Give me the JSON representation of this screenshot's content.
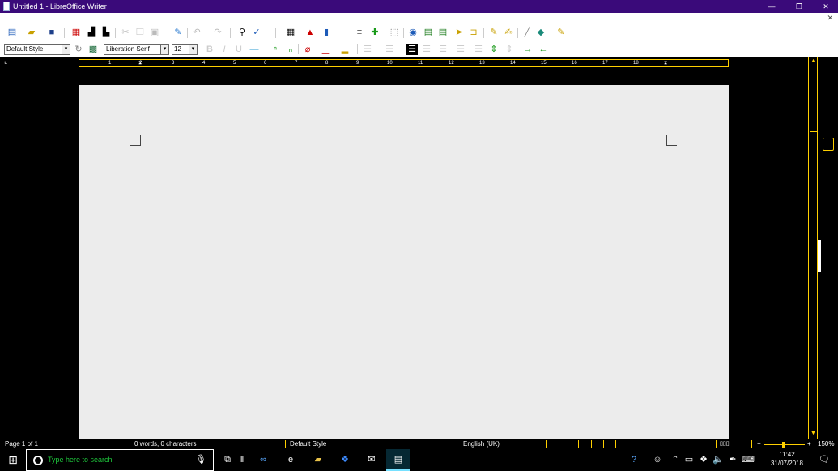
{
  "window": {
    "title": "Untitled 1 - LibreOffice Writer",
    "minimize": "—",
    "restore": "❐",
    "close": "✕"
  },
  "menubar": {
    "close_doc": "✕"
  },
  "toolbar_standard": {
    "icons": [
      "new-document",
      "open-folder",
      "save",
      "export-pdf",
      "print",
      "print-preview",
      "cut",
      "copy",
      "paste",
      "clone-formatting",
      "undo",
      "redo",
      "find-replace",
      "spelling",
      "insert-table",
      "insert-image",
      "insert-chart",
      "insert-text-box",
      "insert-page-break",
      "insert-field",
      "insert-special-character",
      "insert-hyperlink",
      "insert-footnote",
      "insert-endnote",
      "insert-bookmark",
      "insert-cross-reference",
      "insert-comment",
      "track-changes",
      "insert-line",
      "insert-shapes",
      "show-draw-functions"
    ]
  },
  "toolbar_formatting": {
    "paragraph_style": "Default Style",
    "font_name": "Liberation Serif",
    "font_size": "12",
    "dropdown_arrow": "▾"
  },
  "ruler": {
    "numbers": [
      "1",
      "2",
      "3",
      "4",
      "5",
      "6",
      "7",
      "8",
      "9",
      "10",
      "11",
      "12",
      "13",
      "14",
      "15",
      "16",
      "17",
      "18"
    ]
  },
  "statusbar": {
    "page": "Page 1 of 1",
    "words": "0 words, 0 characters",
    "page_style": "Default Style",
    "language": "English (UK)",
    "zoom": "150%"
  },
  "taskbar": {
    "search_placeholder": "Type here to search",
    "time": "11:42",
    "date": "31/07/2018"
  },
  "colors": {
    "title_bar": "#3a0a7a",
    "high_contrast_accent": "#ffd000",
    "search_text": "#1ec73c"
  }
}
